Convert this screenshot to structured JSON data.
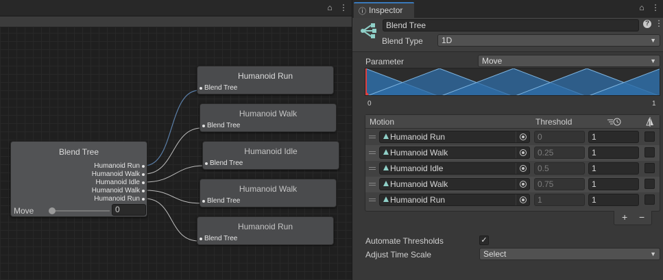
{
  "colors": {
    "accent": "#3a79bb",
    "connection": "#5b7fa8",
    "edge": "#bdbdbd",
    "blend_fill": "#2f6ea8",
    "blend_line": "#7fb5e0"
  },
  "graph": {
    "blend_tree_node": {
      "title": "Blend Tree",
      "outputs": [
        "Humanoid Run",
        "Humanoid Walk",
        "Humanoid Idle",
        "Humanoid Walk",
        "Humanoid Run"
      ],
      "param_label": "Move",
      "param_value": "0",
      "slider_fraction": 0.0
    },
    "motion_nodes": [
      {
        "title": "Humanoid Run",
        "port": "Blend Tree"
      },
      {
        "title": "Humanoid Walk",
        "port": "Blend Tree"
      },
      {
        "title": "Humanoid Idle",
        "port": "Blend Tree"
      },
      {
        "title": "Humanoid Walk",
        "port": "Blend Tree"
      },
      {
        "title": "Humanoid Run",
        "port": "Blend Tree"
      }
    ]
  },
  "inspector": {
    "tab_label": "Inspector",
    "tab_icon": "info-icon",
    "name": "Blend Tree",
    "blend_type_label": "Blend Type",
    "blend_type": "1D",
    "parameter_label": "Parameter",
    "parameter": "Move",
    "range_min": "0",
    "range_max": "1",
    "motion_header": "Motion",
    "threshold_header": "Threshold",
    "speed_header_icon": "time-scale-icon",
    "mirror_header_icon": "mirror-icon",
    "motions": [
      {
        "clip": "Humanoid Run",
        "threshold": "0",
        "speed": "1"
      },
      {
        "clip": "Humanoid Walk",
        "threshold": "0.25",
        "speed": "1"
      },
      {
        "clip": "Humanoid Idle",
        "threshold": "0.5",
        "speed": "1"
      },
      {
        "clip": "Humanoid Walk",
        "threshold": "0.75",
        "speed": "1"
      },
      {
        "clip": "Humanoid Run",
        "threshold": "1",
        "speed": "1"
      }
    ],
    "add_label": "+",
    "remove_label": "−",
    "automate_label": "Automate Thresholds",
    "automate_checked": "✓",
    "adjust_label": "Adjust Time Scale",
    "adjust_value": "Select"
  }
}
